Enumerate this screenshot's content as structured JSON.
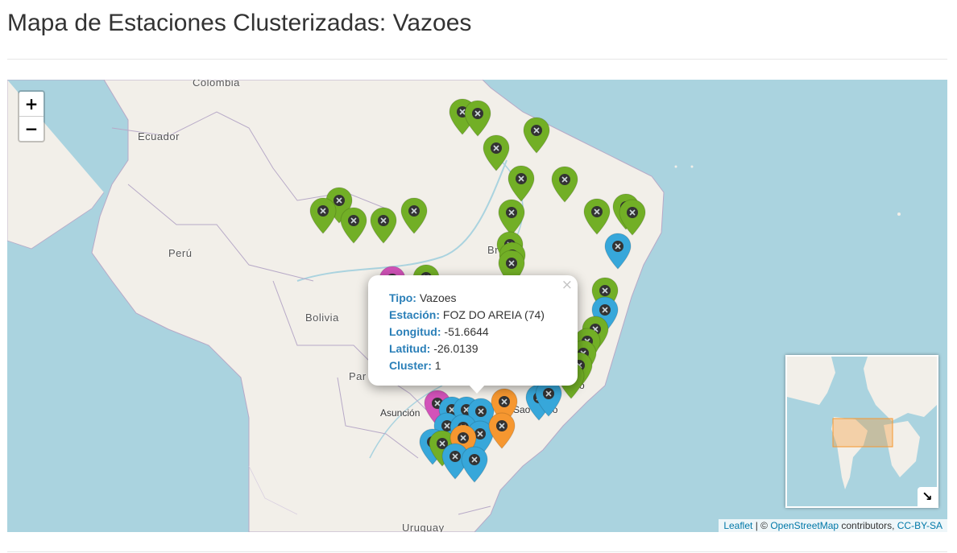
{
  "page": {
    "title": "Mapa de Estaciones Clusterizadas: Vazoes"
  },
  "colors": {
    "cluster_1": "#37a7da",
    "cluster_2": "#72af26",
    "cluster_3": "#f69730",
    "cluster_4": "#d252b9",
    "link": "#0078a8",
    "popup_label": "#2a7fb8"
  },
  "map": {
    "labels": {
      "colombia": "Colombia",
      "ecuador": "Ecuador",
      "peru": "Perú",
      "bolivia": "Bolivia",
      "paraguay_partial": "Par",
      "brasil_partial": "Br",
      "uruguay": "Uruguay"
    },
    "cities": {
      "asuncion": "Asunción",
      "sao_paulo": "Sao Paulo",
      "rio_partial": "neiro"
    },
    "zoom": {
      "in_label": "+",
      "out_label": "−"
    },
    "marker_icon": "close-circle-icon"
  },
  "popup": {
    "close_label": "×",
    "fields": [
      {
        "label": "Tipo:",
        "value": "Vazoes"
      },
      {
        "label": "Estación:",
        "value": "FOZ DO AREIA (74)"
      },
      {
        "label": "Longitud:",
        "value": "-51.6644"
      },
      {
        "label": "Latitud:",
        "value": "-26.0139"
      },
      {
        "label": "Cluster:",
        "value": "1"
      }
    ]
  },
  "minimap": {
    "toggle_icon": "collapse-arrow-icon",
    "toggle_glyph": "↘"
  },
  "attribution": {
    "leaflet": "Leaflet",
    "sep": " | © ",
    "osm": "OpenStreetMap",
    "contrib": " contributors, ",
    "license": "CC-BY-SA"
  }
}
